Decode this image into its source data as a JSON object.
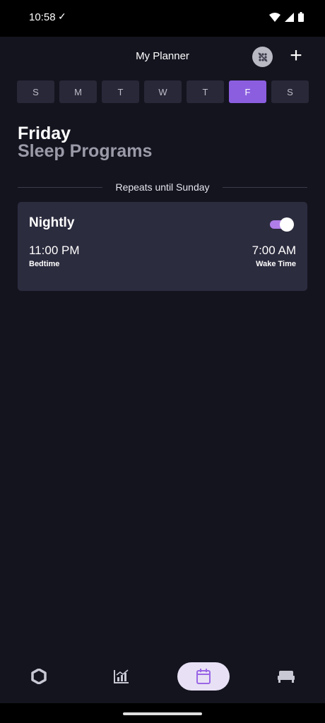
{
  "status_bar": {
    "time": "10:58",
    "check": "✓"
  },
  "header": {
    "title": "My Planner",
    "add_label": "+"
  },
  "days": [
    {
      "label": "S",
      "active": false
    },
    {
      "label": "M",
      "active": false
    },
    {
      "label": "T",
      "active": false
    },
    {
      "label": "W",
      "active": false
    },
    {
      "label": "T",
      "active": false
    },
    {
      "label": "F",
      "active": true
    },
    {
      "label": "S",
      "active": false
    }
  ],
  "heading": {
    "day": "Friday",
    "subtitle": "Sleep Programs"
  },
  "repeats_text": "Repeats until Sunday",
  "program": {
    "name": "Nightly",
    "enabled": true,
    "bedtime_value": "11:00 PM",
    "bedtime_label": "Bedtime",
    "wake_value": "7:00 AM",
    "wake_label": "Wake Time"
  },
  "nav": {
    "items": [
      "hexagon-icon",
      "chart-icon",
      "calendar-icon",
      "bed-icon"
    ],
    "active": "calendar-icon"
  },
  "colors": {
    "background": "#14141f",
    "accent": "#8b5ee0",
    "card": "#2c2c3f"
  }
}
